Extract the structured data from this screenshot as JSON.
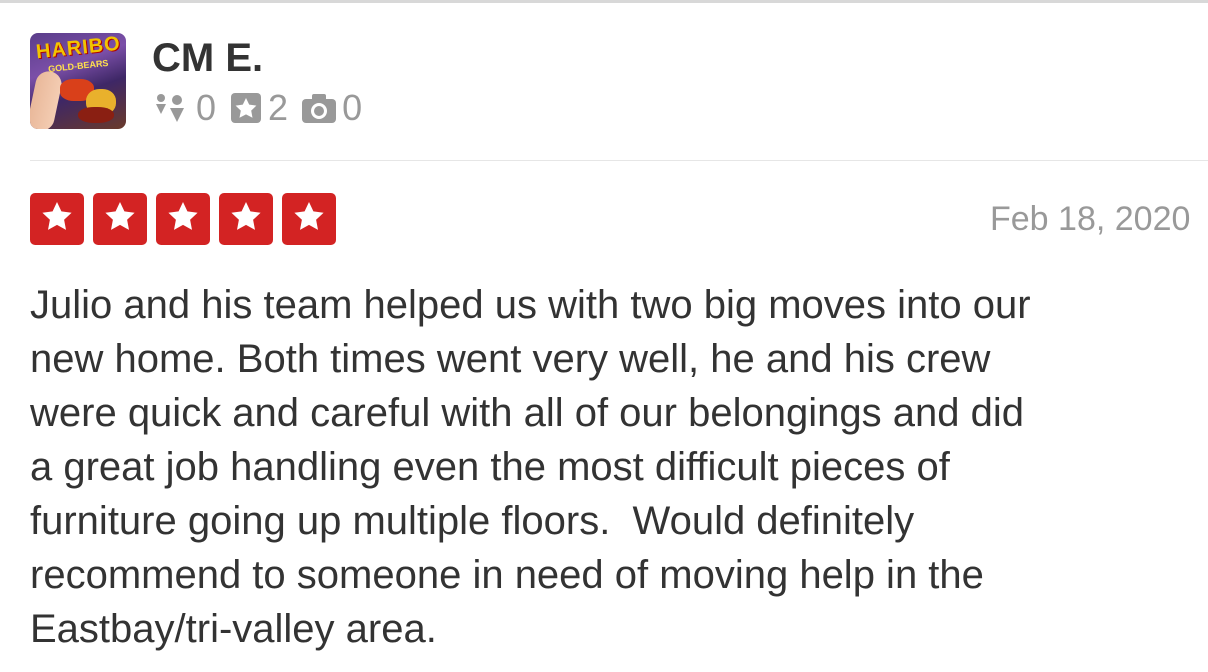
{
  "user": {
    "name": "CM E.",
    "avatar_text": "HARIBO",
    "avatar_subtext": "GOLD-BEARS",
    "stats": {
      "friends": "0",
      "reviews": "2",
      "photos": "0"
    }
  },
  "review": {
    "rating": 5,
    "max_rating": 5,
    "date": "Feb 18, 2020",
    "text": "Julio and his team helped us with two big moves into our\nnew home. Both times went very well, he and his crew\nwere quick and careful with all of our belongings and did\na great job handling even the most difficult pieces of\nfurniture going up multiple floors.  Would definitely\nrecommend to someone in need of moving help in the\nEastbay/tri-valley area."
  },
  "colors": {
    "star_red": "#d32323",
    "text": "#333333",
    "muted": "#999999"
  },
  "icons": [
    "friends-icon",
    "review-star-icon",
    "camera-icon",
    "star-icon"
  ]
}
